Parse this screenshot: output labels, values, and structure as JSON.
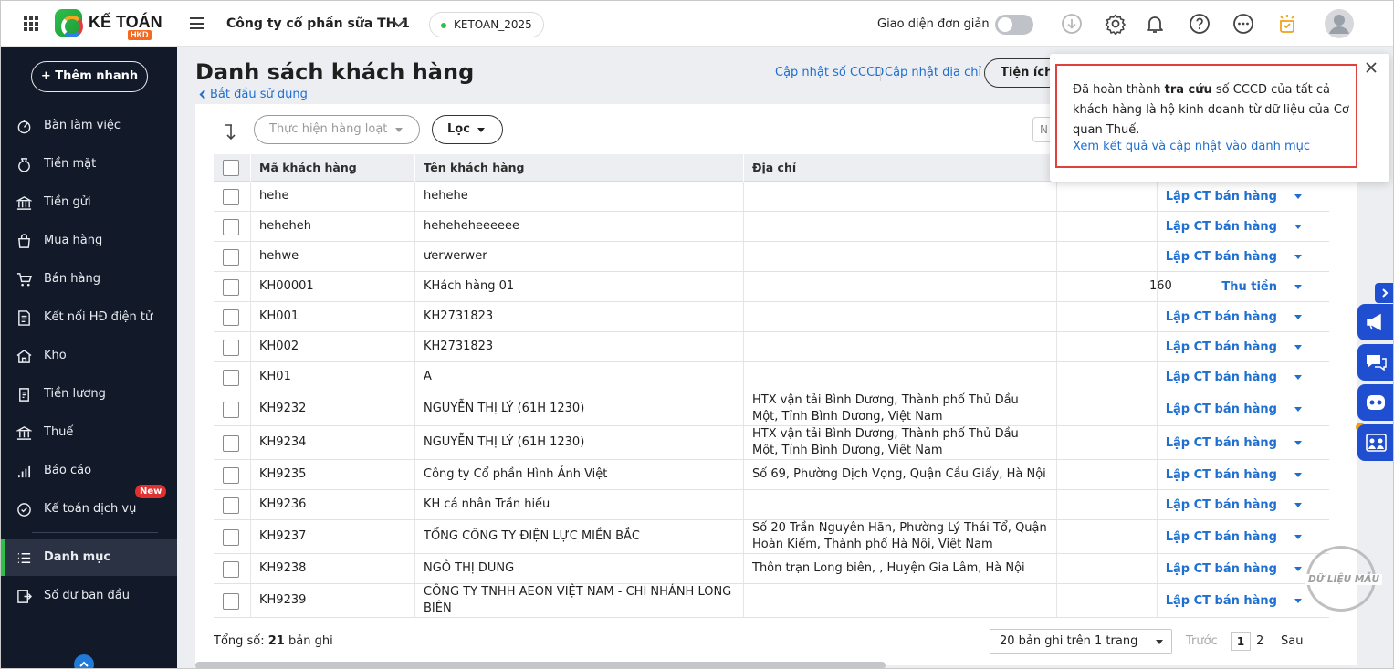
{
  "header": {
    "brand": "KẾ TOÁN",
    "brand_sub": "HKD",
    "company": "Công ty cổ phần sữa TH 1",
    "database": "KETOAN_2025",
    "simple_ui_label": "Giao diện đơn giản"
  },
  "sidebar": {
    "quick_add": "+ Thêm nhanh",
    "items": [
      {
        "label": "Bàn làm việc",
        "icon": "dashboard-icon"
      },
      {
        "label": "Tiền mặt",
        "icon": "cash-icon"
      },
      {
        "label": "Tiền gửi",
        "icon": "bank-icon"
      },
      {
        "label": "Mua hàng",
        "icon": "shopping-bag-icon"
      },
      {
        "label": "Bán hàng",
        "icon": "cart-icon"
      },
      {
        "label": "Kết nối HĐ điện tử",
        "icon": "e-invoice-icon"
      },
      {
        "label": "Kho",
        "icon": "warehouse-icon"
      },
      {
        "label": "Tiền lương",
        "icon": "payroll-icon"
      },
      {
        "label": "Thuế",
        "icon": "tax-icon"
      },
      {
        "label": "Báo cáo",
        "icon": "report-icon"
      },
      {
        "label": "Kế toán dịch vụ",
        "icon": "service-icon",
        "badge": "New"
      },
      {
        "label": "Danh mục",
        "icon": "list-icon"
      },
      {
        "label": "Số dư ban đầu",
        "icon": "opening-balance-icon"
      }
    ]
  },
  "page": {
    "title": "Danh sách khách hàng",
    "back_link": "Bắt đầu sử dụng",
    "link_update_cccd": "Cập nhật số CCCD",
    "link_update_address": "Cập nhật địa chỉ",
    "utilities_button": "Tiện ích",
    "batch_button": "Thực hiện hàng loạt",
    "filter_button": "Lọc",
    "search_partial": "N"
  },
  "table": {
    "columns": [
      "Mã khách hàng",
      "Tên khách hàng",
      "Địa chỉ"
    ],
    "rows": [
      {
        "code": "hehe",
        "name": "hehehe",
        "address": "",
        "amount": "",
        "action": "Lập CT bán hàng"
      },
      {
        "code": "heheheh",
        "name": "heheheheeeeee",
        "address": "",
        "amount": "",
        "action": "Lập CT bán hàng"
      },
      {
        "code": "hehwe",
        "name": "ưerwerwer",
        "address": "",
        "amount": "",
        "action": "Lập CT bán hàng"
      },
      {
        "code": "KH00001",
        "name": "KHách hàng 01",
        "address": "",
        "amount": "160",
        "action": "Thu tiền"
      },
      {
        "code": "KH001",
        "name": "KH2731823",
        "address": "",
        "amount": "",
        "action": "Lập CT bán hàng"
      },
      {
        "code": "KH002",
        "name": "KH2731823",
        "address": "",
        "amount": "",
        "action": "Lập CT bán hàng"
      },
      {
        "code": "KH01",
        "name": "A",
        "address": "",
        "amount": "",
        "action": "Lập CT bán hàng"
      },
      {
        "code": "KH9232",
        "name": "NGUYỄN THỊ LÝ (61H 1230)",
        "address": "HTX vận tải Bình Dương, Thành phố Thủ Dầu Một, Tỉnh Bình Dương, Việt Nam",
        "amount": "",
        "action": "Lập CT bán hàng"
      },
      {
        "code": "KH9234",
        "name": "NGUYỄN THỊ LÝ (61H 1230)",
        "address": "HTX vận tải Bình Dương, Thành phố Thủ Dầu Một, Tỉnh Bình Dương, Việt Nam",
        "amount": "",
        "action": "Lập CT bán hàng"
      },
      {
        "code": "KH9235",
        "name": "Công ty Cổ phần Hình Ảnh Việt",
        "address": "Số 69, Phường Dịch Vọng, Quận Cầu Giấy, Hà Nội",
        "amount": "",
        "action": "Lập CT bán hàng"
      },
      {
        "code": "KH9236",
        "name": "KH cá nhân Trần hiếu",
        "address": "",
        "amount": "",
        "action": "Lập CT bán hàng"
      },
      {
        "code": "KH9237",
        "name": "TỔNG CÔNG TY ĐIỆN LỰC MIỀN BẮC",
        "address": "Số 20 Trần Nguyên Hãn, Phường Lý Thái Tổ, Quận Hoàn Kiếm, Thành phố Hà Nội, Việt Nam",
        "amount": "",
        "action": "Lập CT bán hàng"
      },
      {
        "code": "KH9238",
        "name": "NGÔ THỊ DUNG",
        "address": "Thôn trạn Long biên, , Huyện Gia Lâm, Hà Nội",
        "amount": "",
        "action": "Lập CT bán hàng"
      },
      {
        "code": "KH9239",
        "name": "CÔNG TY TNHH AEON VIỆT NAM - CHI NHÁNH LONG BIÊN",
        "address": "",
        "amount": "",
        "action": "Lập CT bán hàng"
      }
    ]
  },
  "footer": {
    "total_prefix": "Tổng số: ",
    "total_count": "21",
    "total_suffix": " bản ghi",
    "page_size": "20 bản ghi trên 1 trang",
    "prev": "Trước",
    "page1": "1",
    "page2": "2",
    "next": "Sau"
  },
  "popup": {
    "text_before": "Đã hoàn thành ",
    "text_bold": "tra cứu",
    "text_after": " số CCCD của tất cả khách hàng là hộ kinh doanh từ dữ liệu của Cơ quan Thuế.",
    "link": "Xem kết quả và cập nhật vào danh mục"
  },
  "stamp": "DỮ LIỆU MẪU",
  "colors": {
    "accent_green": "#2fbf4a",
    "link_blue": "#1f6fd1",
    "sidebar_bg": "#121a2a",
    "alert_red": "#e0413d",
    "rail_blue": "#1f4fd0"
  }
}
